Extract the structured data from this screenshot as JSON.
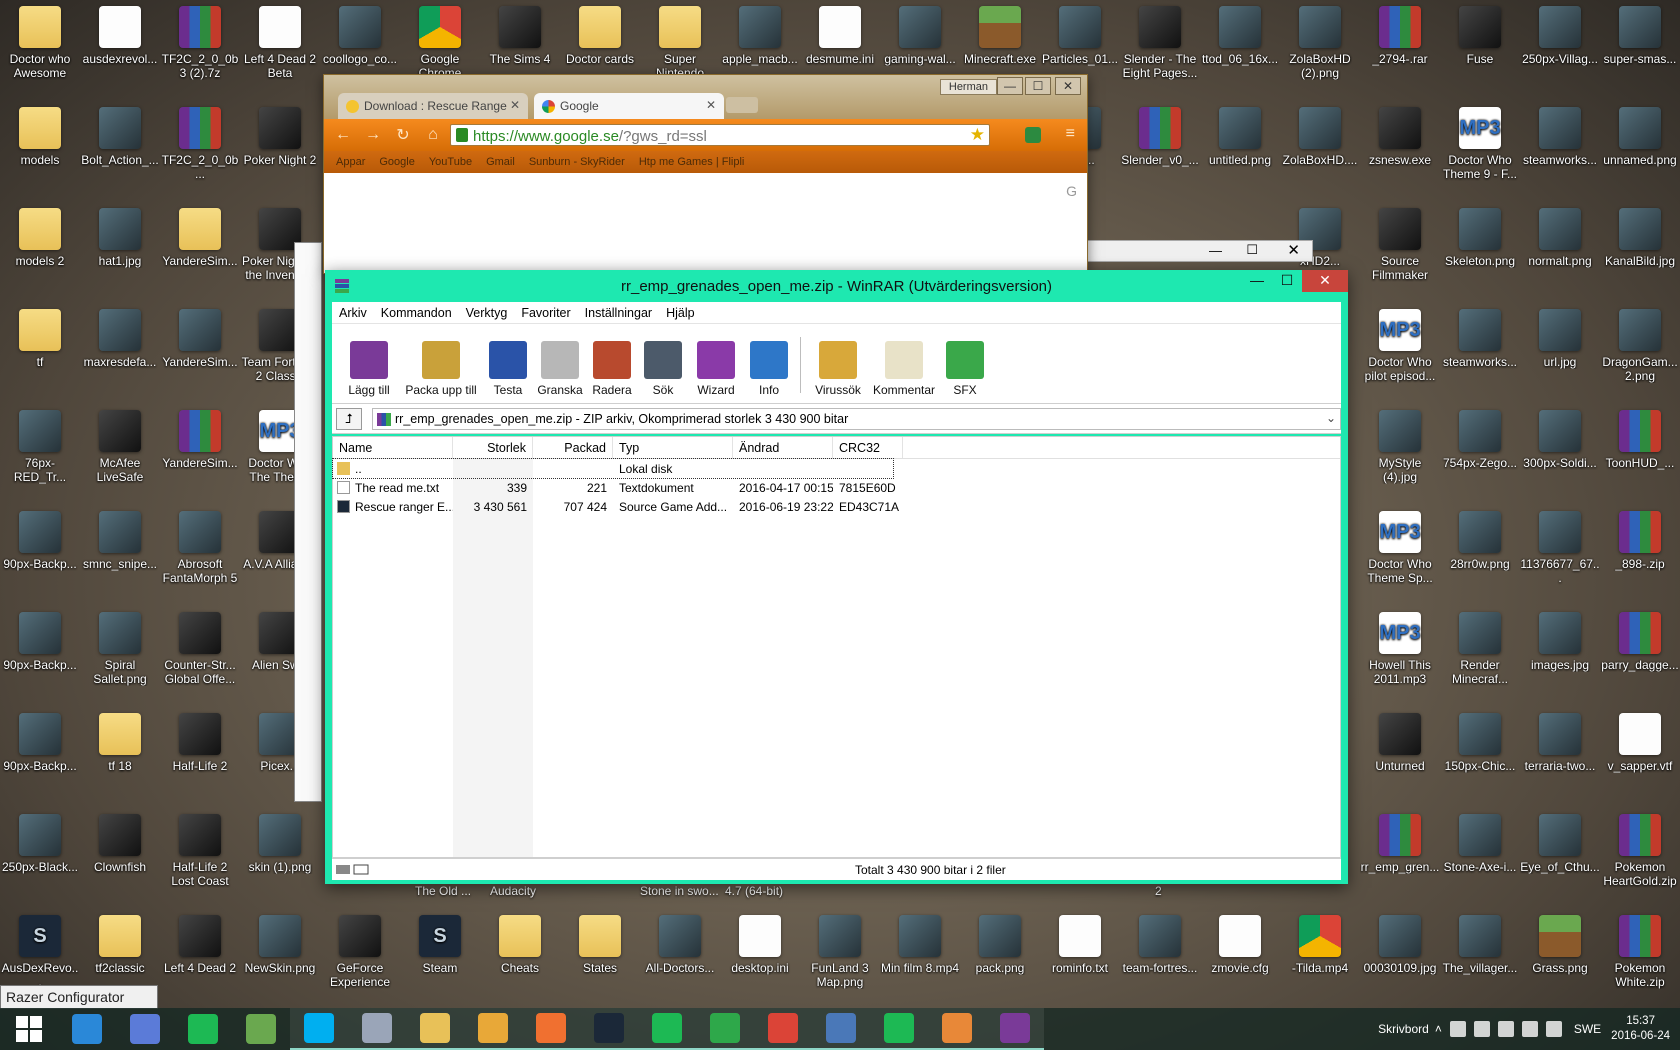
{
  "desktop": {
    "icons": [
      {
        "label": "Doctor who Awesome",
        "kind": "folder"
      },
      {
        "label": "ausdexrevol...",
        "kind": "doc"
      },
      {
        "label": "TF2C_2_0_0b3 (2).7z",
        "kind": "rar"
      },
      {
        "label": "Left 4 Dead 2 Beta",
        "kind": "doc"
      },
      {
        "label": "coollogo_co...",
        "kind": "img"
      },
      {
        "label": "Google Chrome",
        "kind": "chrome"
      },
      {
        "label": "The Sims 4",
        "kind": "app"
      },
      {
        "label": "Doctor cards",
        "kind": "folder"
      },
      {
        "label": "Super Nintendo",
        "kind": "folder"
      },
      {
        "label": "apple_macb...",
        "kind": "img"
      },
      {
        "label": "desmume.ini",
        "kind": "doc"
      },
      {
        "label": "gaming-wal...",
        "kind": "img"
      },
      {
        "label": "Minecraft.exe",
        "kind": "grass"
      },
      {
        "label": "Particles_01...",
        "kind": "img"
      },
      {
        "label": "Slender - The Eight Pages...",
        "kind": "app"
      },
      {
        "label": "ttod_06_16x...",
        "kind": "img"
      },
      {
        "label": "ZolaBoxHD (2).png",
        "kind": "img"
      },
      {
        "label": "_2794-.rar",
        "kind": "rar"
      },
      {
        "label": "Fuse",
        "kind": "app"
      },
      {
        "label": "250px-Villag...",
        "kind": "img"
      },
      {
        "label": "super-smas...",
        "kind": "img"
      },
      {
        "label": "models",
        "kind": "folder"
      },
      {
        "label": "Bolt_Action_...",
        "kind": "img"
      },
      {
        "label": "TF2C_2_0_0b...",
        "kind": "rar"
      },
      {
        "label": "Poker Night 2",
        "kind": "app"
      },
      {
        "label": "MO...",
        "kind": "img"
      },
      {
        "label": "Slender_v0_...",
        "kind": "rar"
      },
      {
        "label": "untitled.png",
        "kind": "img"
      },
      {
        "label": "ZolaBoxHD....",
        "kind": "img"
      },
      {
        "label": "zsnesw.exe",
        "kind": "app"
      },
      {
        "label": "Doctor Who Theme 9 - F...",
        "kind": "mp3"
      },
      {
        "label": "steamworks...",
        "kind": "img"
      },
      {
        "label": "unnamed.png",
        "kind": "img"
      },
      {
        "label": "models 2",
        "kind": "folder"
      },
      {
        "label": "hat1.jpg",
        "kind": "img"
      },
      {
        "label": "YandereSim...",
        "kind": "folder"
      },
      {
        "label": "Poker Night at the Inventory",
        "kind": "app"
      },
      {
        "label": "xHD2...",
        "kind": "img"
      },
      {
        "label": "Source Filmmaker",
        "kind": "app"
      },
      {
        "label": "Skeleton.png",
        "kind": "img"
      },
      {
        "label": "normalt.png",
        "kind": "img"
      },
      {
        "label": "KanalBild.jpg",
        "kind": "img"
      },
      {
        "label": "tf",
        "kind": "folder"
      },
      {
        "label": "maxresdefa...",
        "kind": "img"
      },
      {
        "label": "YandereSim...",
        "kind": "img"
      },
      {
        "label": "Team Fortress 2 Classic",
        "kind": "app"
      },
      {
        "label": "Doctor Who pilot episod...",
        "kind": "mp3"
      },
      {
        "label": "steamworks...",
        "kind": "img"
      },
      {
        "label": "url.jpg",
        "kind": "img"
      },
      {
        "label": "DragonGam... 2.png",
        "kind": "img"
      },
      {
        "label": "76px-RED_Tr...",
        "kind": "img"
      },
      {
        "label": "McAfee LiveSafe",
        "kind": "app"
      },
      {
        "label": "YandereSim...",
        "kind": "rar"
      },
      {
        "label": "Doctor Who The Theme",
        "kind": "mp3"
      },
      {
        "label": "MyStyle (4).jpg",
        "kind": "img"
      },
      {
        "label": "754px-Zego...",
        "kind": "img"
      },
      {
        "label": "300px-Soldi...",
        "kind": "img"
      },
      {
        "label": "ToonHUD_...",
        "kind": "rar"
      },
      {
        "label": "90px-Backp...",
        "kind": "img"
      },
      {
        "label": "smnc_snipe...",
        "kind": "img"
      },
      {
        "label": "Abrosoft FantaMorph 5",
        "kind": "img"
      },
      {
        "label": "A.V.A Alliance",
        "kind": "app"
      },
      {
        "label": "Doctor Who Theme Sp...",
        "kind": "mp3"
      },
      {
        "label": "28rr0w.png",
        "kind": "img"
      },
      {
        "label": "11376677_67...",
        "kind": "img"
      },
      {
        "label": "_898-.zip",
        "kind": "rar"
      },
      {
        "label": "90px-Backp...",
        "kind": "img"
      },
      {
        "label": "Spiral Sallet.png",
        "kind": "img"
      },
      {
        "label": "Counter-Str... Global Offe...",
        "kind": "app"
      },
      {
        "label": "Alien Sw...",
        "kind": "app"
      },
      {
        "label": "Howell This 2011.mp3",
        "kind": "mp3"
      },
      {
        "label": "Render Minecraf...",
        "kind": "img"
      },
      {
        "label": "images.jpg",
        "kind": "img"
      },
      {
        "label": "parry_dagge...",
        "kind": "rar"
      },
      {
        "label": "90px-Backp...",
        "kind": "img"
      },
      {
        "label": "tf 18",
        "kind": "folder"
      },
      {
        "label": "Half-Life 2",
        "kind": "app"
      },
      {
        "label": "Picex...",
        "kind": "img"
      },
      {
        "label": "Unturned",
        "kind": "app"
      },
      {
        "label": "150px-Chic...",
        "kind": "img"
      },
      {
        "label": "terraria-two...",
        "kind": "img"
      },
      {
        "label": "v_sapper.vtf",
        "kind": "doc"
      },
      {
        "label": "250px-Black...",
        "kind": "img"
      },
      {
        "label": "Clownfish",
        "kind": "app"
      },
      {
        "label": "Half-Life 2 Lost Coast",
        "kind": "app"
      },
      {
        "label": "skin (1).png",
        "kind": "img"
      },
      {
        "label": "rr_emp_gren...",
        "kind": "rar"
      },
      {
        "label": "Stone-Axe-i...",
        "kind": "img"
      },
      {
        "label": "Eye_of_Cthu...",
        "kind": "img"
      },
      {
        "label": "Pokemon HeartGold.zip",
        "kind": "rar"
      },
      {
        "label": "AusDexRevo...",
        "kind": "steam"
      },
      {
        "label": "tf2classic",
        "kind": "folder"
      },
      {
        "label": "Left 4 Dead 2",
        "kind": "app"
      },
      {
        "label": "NewSkin.png",
        "kind": "img"
      },
      {
        "label": "GeForce Experience",
        "kind": "app"
      },
      {
        "label": "Steam",
        "kind": "steam"
      },
      {
        "label": "Cheats",
        "kind": "folder"
      },
      {
        "label": "States",
        "kind": "folder"
      },
      {
        "label": "All-Doctors...",
        "kind": "img"
      },
      {
        "label": "desktop.ini",
        "kind": "doc"
      },
      {
        "label": "FunLand 3 Map.png",
        "kind": "img"
      },
      {
        "label": "Min film 8.mp4",
        "kind": "img"
      },
      {
        "label": "pack.png",
        "kind": "img"
      },
      {
        "label": "rominfo.txt",
        "kind": "doc"
      },
      {
        "label": "team-fortres...",
        "kind": "img"
      },
      {
        "label": "zmovie.cfg",
        "kind": "doc"
      },
      {
        "label": "-Tilda.mp4",
        "kind": "chrome"
      },
      {
        "label": "00030109.jpg",
        "kind": "img"
      },
      {
        "label": "The_villager...",
        "kind": "img"
      },
      {
        "label": "Grass.png",
        "kind": "grass"
      },
      {
        "label": "Pokemon White.zip",
        "kind": "rar"
      }
    ],
    "obscured_labels": [
      "The Old ...",
      "Audacity",
      "Stone in swo...",
      "4.7 (64-bit)",
      "2"
    ]
  },
  "chrome": {
    "tabs": [
      {
        "title": "Download : Rescue Range"
      },
      {
        "title": "Google"
      }
    ],
    "user": "Herman",
    "url_host": "https://www.google.se",
    "url_path": "/?gws_rd=ssl",
    "bookmarks": [
      "Appar",
      "Google",
      "YouTube",
      "Gmail",
      "Sunburn - SkyRider",
      "Htp me Games | Flipli"
    ],
    "page_char": "G"
  },
  "winrar": {
    "title": "rr_emp_grenades_open_me.zip - WinRAR (Utvärderingsversion)",
    "menu": [
      "Arkiv",
      "Kommandon",
      "Verktyg",
      "Favoriter",
      "Inställningar",
      "Hjälp"
    ],
    "toolbar": [
      {
        "label": "Lägg till",
        "color": "#7a3a98"
      },
      {
        "label": "Packa upp till",
        "color": "#c9a13a"
      },
      {
        "label": "Testa",
        "color": "#2a53a8"
      },
      {
        "label": "Granska",
        "color": "#b7b7b7"
      },
      {
        "label": "Radera",
        "color": "#b84a2e"
      },
      {
        "label": "Sök",
        "color": "#4c5a6a"
      },
      {
        "label": "Wizard",
        "color": "#8a3aa8"
      },
      {
        "label": "Info",
        "color": "#2e77c8"
      }
    ],
    "toolbar_right": [
      {
        "label": "Virussök",
        "color": "#d8a83a"
      },
      {
        "label": "Kommentar",
        "color": "#e8e2c8"
      },
      {
        "label": "SFX",
        "color": "#3aa84a"
      }
    ],
    "path": "rr_emp_grenades_open_me.zip - ZIP arkiv, Okomprimerad storlek 3 430 900 bitar",
    "columns": {
      "name": "Name",
      "size": "Storlek",
      "packed": "Packad",
      "type": "Typ",
      "modified": "Ändrad",
      "crc": "CRC32"
    },
    "parent_row": {
      "name": "..",
      "type": "Lokal disk"
    },
    "files": [
      {
        "name": "The read me.txt",
        "size": "339",
        "packed": "221",
        "type": "Textdokument",
        "modified": "2016-04-17 00:15",
        "crc": "7815E60D"
      },
      {
        "name": "Rescue ranger E...",
        "size": "3 430 561",
        "packed": "707 424",
        "type": "Source Game Add...",
        "modified": "2016-06-19 23:22",
        "crc": "ED43C71A"
      }
    ],
    "status_total": "Totalt 3 430 900 bitar i 2 filer"
  },
  "tooltip": "Razer Configurator",
  "taskbar": {
    "items": [
      "start",
      "internet-explorer",
      "document-viewer",
      "spotify",
      "minecraft",
      "skype",
      "task-manager",
      "file-explorer",
      "paint",
      "origin",
      "steam",
      "cloud",
      "store",
      "chrome",
      "control-panel",
      "spotify-2",
      "media-player",
      "winrar"
    ],
    "desktop_label": "Skrivbord",
    "language": "SWE",
    "time": "15:37",
    "date": "2016-06-24"
  }
}
